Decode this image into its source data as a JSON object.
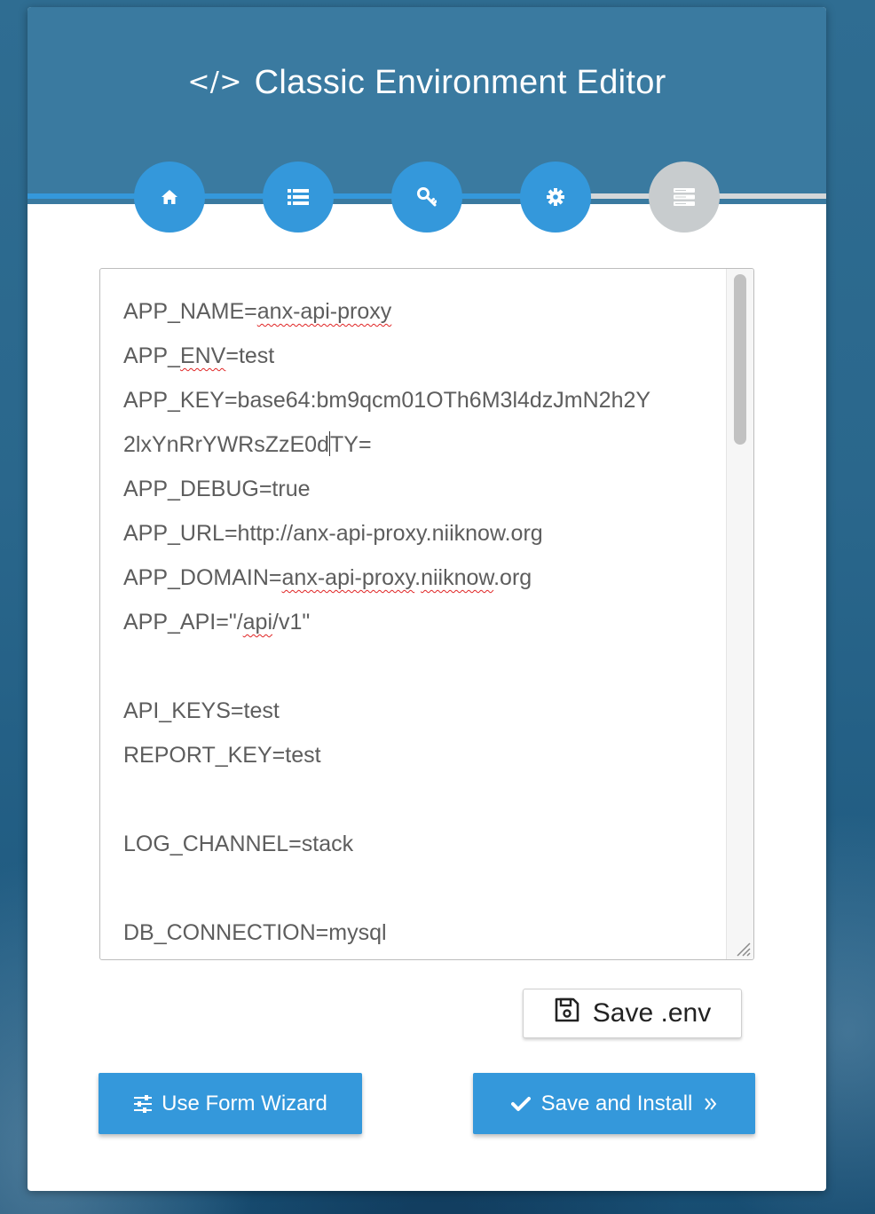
{
  "header": {
    "title_icon": "</>",
    "title": "Classic Environment Editor"
  },
  "steps": [
    {
      "icon": "home-icon",
      "state": "complete"
    },
    {
      "icon": "list-icon",
      "state": "complete"
    },
    {
      "icon": "key-icon",
      "state": "complete"
    },
    {
      "icon": "gear-icon",
      "state": "complete"
    },
    {
      "icon": "server-icon",
      "state": "inactive"
    }
  ],
  "editor": {
    "lines": [
      "APP_NAME=anx-api-proxy",
      "APP_ENV=test",
      "APP_KEY=base64:bm9qcm01OTh6M3l4dzJmN2h2Y",
      "2lxYnRrYWRsZzE0dTY=",
      "APP_DEBUG=true",
      "APP_URL=http://anx-api-proxy.niiknow.org",
      "APP_DOMAIN=anx-api-proxy.niiknow.org",
      "APP_API=\"/api/v1\"",
      "",
      "API_KEYS=test",
      "REPORT_KEY=test",
      "",
      "LOG_CHANNEL=stack",
      "",
      "DB_CONNECTION=mysql"
    ]
  },
  "buttons": {
    "save_env": "Save .env",
    "use_form_wizard": "Use Form Wizard",
    "save_and_install": "Save and Install"
  },
  "colors": {
    "header": "#3a7aa0",
    "accent": "#3498db",
    "inactive_step": "#c8ccce"
  }
}
